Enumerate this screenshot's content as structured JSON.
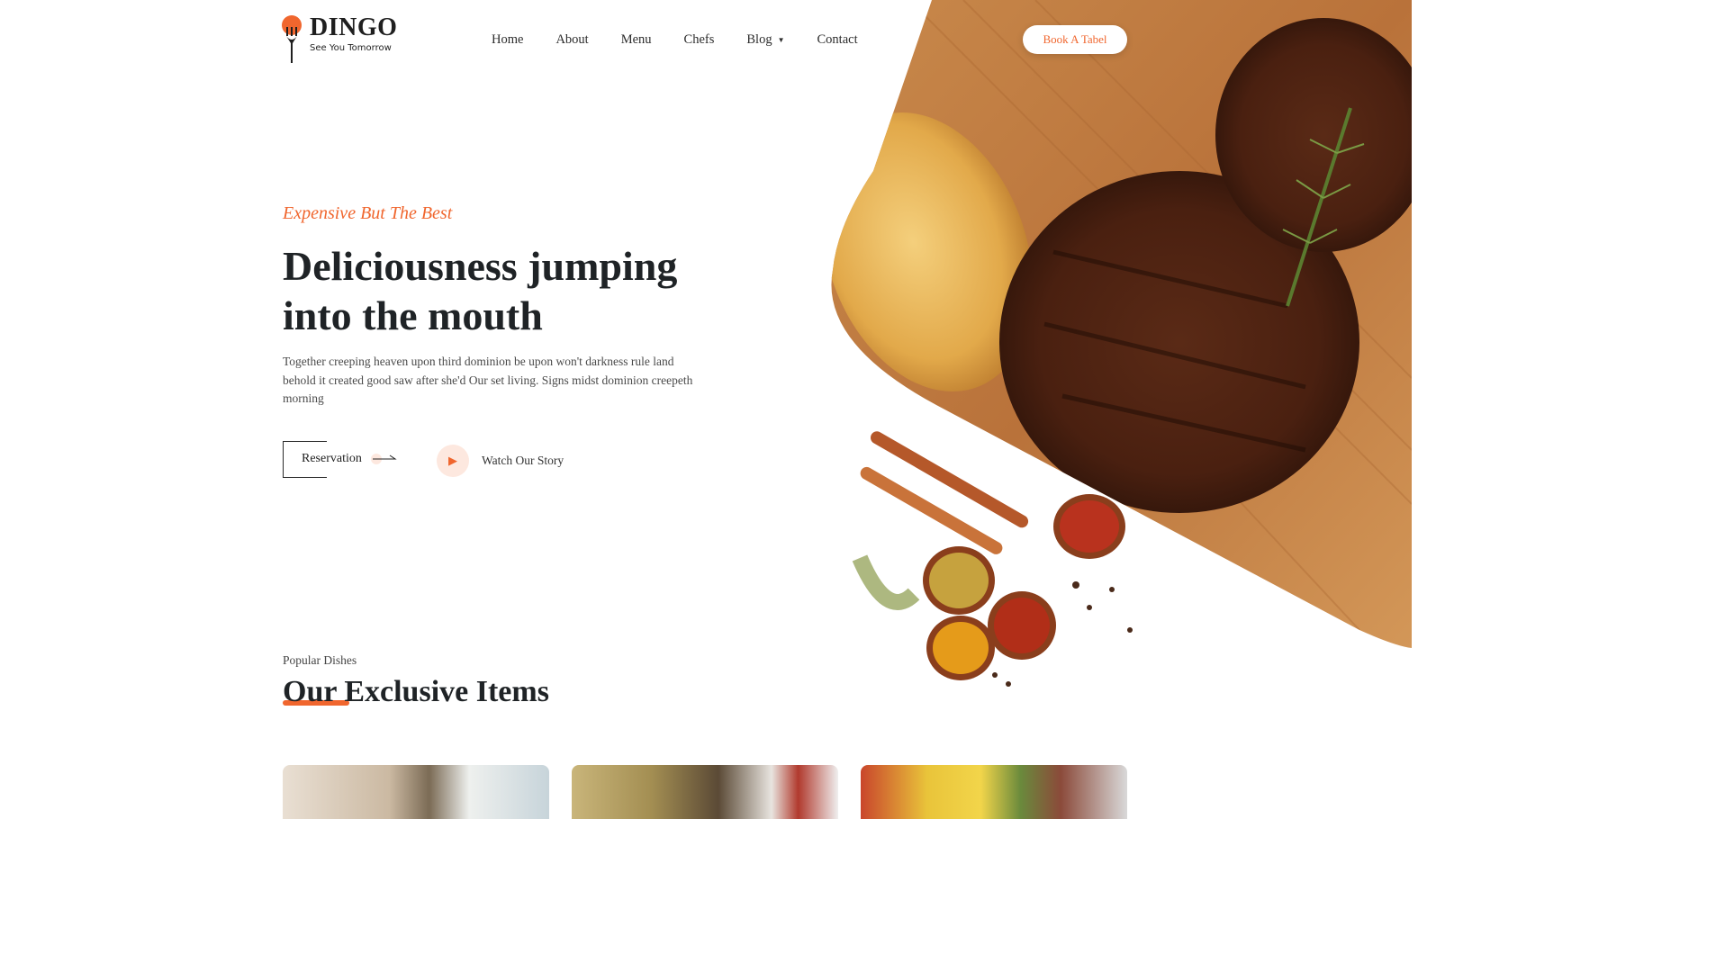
{
  "brand": {
    "name": "DINGO",
    "tagline": "See You Tomorrow"
  },
  "nav": {
    "items": [
      "Home",
      "About",
      "Menu",
      "Chefs",
      "Blog",
      "Contact"
    ],
    "blog_has_dropdown": true
  },
  "header": {
    "cta_label": "Book A Tabel"
  },
  "hero": {
    "eyebrow": "Expensive But The Best",
    "headline": "Deliciousness jumping into the mouth",
    "description": "Together creeping heaven upon third dominion be upon won't darkness rule land behold it created good saw after she'd Our set living. Signs midst dominion creepeth morning",
    "reservation_label": "Reservation",
    "watch_label": "Watch Our Story"
  },
  "section": {
    "subtitle": "Popular Dishes",
    "title": "Our Exclusive Items"
  },
  "colors": {
    "accent": "#f0662e",
    "text_dark": "#1f2326"
  },
  "icons": [
    "fork-logo-icon",
    "chevron-down-icon",
    "arrow-right-icon",
    "play-icon"
  ]
}
